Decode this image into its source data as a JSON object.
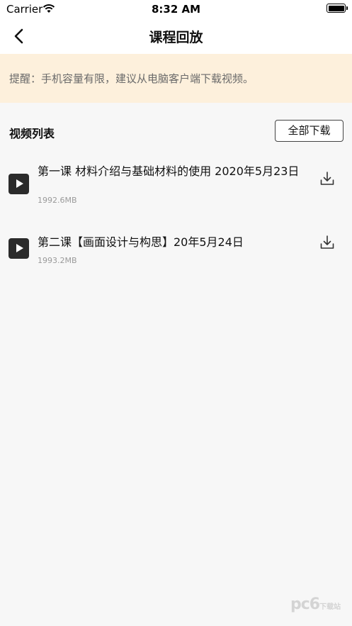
{
  "status_bar": {
    "carrier": "Carrier",
    "time": "8:32 AM"
  },
  "nav": {
    "title": "课程回放"
  },
  "notice": {
    "text": "提醒：手机容量有限，建议从电脑客户端下载视频。"
  },
  "list": {
    "title": "视频列表",
    "download_all_label": "全部下载",
    "items": [
      {
        "title": "第一课 材料介绍与基础材料的使用 2020年5月23日",
        "size": "1992.6MB"
      },
      {
        "title": "第二课【画面设计与构思】20年5月24日",
        "size": "1993.2MB"
      }
    ]
  },
  "icons": {
    "back": "chevron-left-icon",
    "play": "play-icon",
    "download": "download-icon",
    "wifi": "wifi-icon",
    "battery": "battery-icon"
  },
  "watermark": {
    "main": "pc6",
    "sub": "下载站"
  }
}
